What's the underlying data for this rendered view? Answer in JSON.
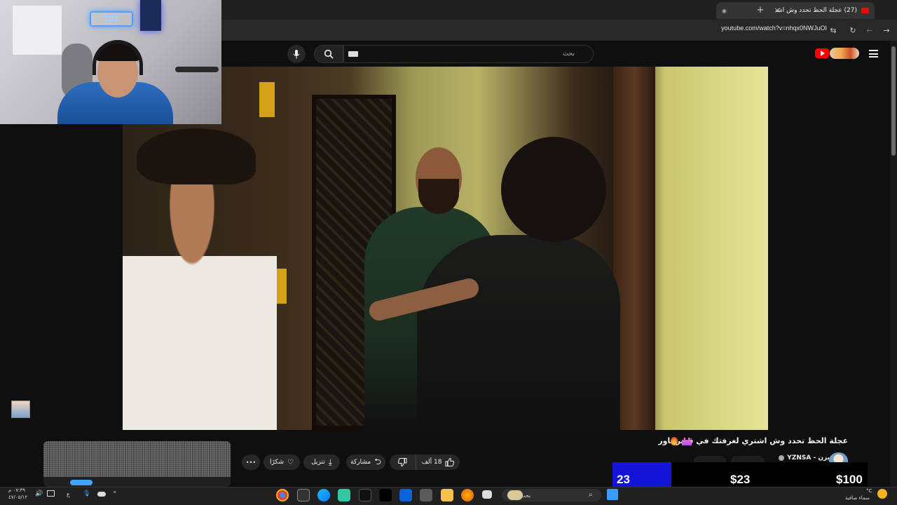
{
  "browser": {
    "tab_title": "(27) عجلة الحظ تحدد وش اشـ",
    "url": "youtube.com/watch?v=nhqx0NWJuOI",
    "new_tab_label": "+",
    "close_tab_label": "×"
  },
  "youtube": {
    "search_placeholder": "بحث"
  },
  "webcam": {
    "neon_sign": "XDX"
  },
  "video": {
    "title": "عجلة الحظ تحدد وش اشتري لغرفتك في قصر باور",
    "channel_name": "يزن - YZNSA",
    "actions": {
      "like_count": "18 ألف",
      "share": "مشاركة",
      "download": "تنزيل",
      "thanks": "شكرًا",
      "more": "•••"
    }
  },
  "donation": {
    "count": "23",
    "amount_a": "$23",
    "amount_b": "$100"
  },
  "taskbar": {
    "search_placeholder": "بحث",
    "time": "٠٧:٣٩ م",
    "date": "٤٧/٠٥/١٢",
    "lang": "ع",
    "weather_temp": "°C",
    "weather_desc": "سماء صافية"
  },
  "colors": {
    "accent_red": "#ff0000",
    "donation_blue": "#1414d9",
    "bg": "#0f0f0f"
  }
}
